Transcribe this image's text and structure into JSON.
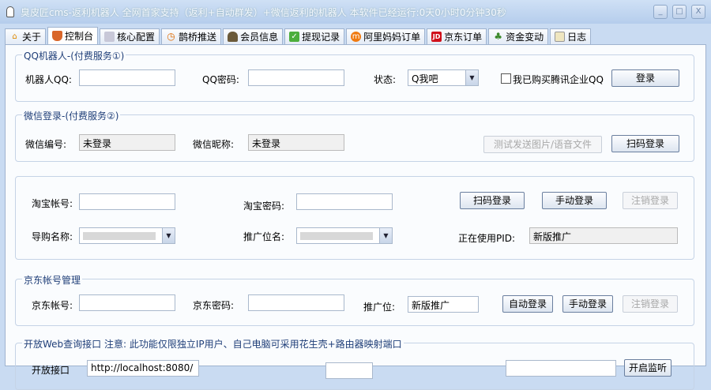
{
  "window": {
    "title": "臭皮匠cms-返利机器人 全网首家支持（返利+自动群发）+微信返利的机器人 本软件已经运行:0天0小时0分钟30秒",
    "minimize": "_",
    "maximize": "□",
    "close": "X"
  },
  "tabs": [
    {
      "label": "关于",
      "icon": "home-icon"
    },
    {
      "label": "控制台",
      "icon": "shield-icon"
    },
    {
      "label": "核心配置",
      "icon": "config-icon"
    },
    {
      "label": "鹊桥推送",
      "icon": "clock-icon"
    },
    {
      "label": "会员信息",
      "icon": "user-icon"
    },
    {
      "label": "提现记录",
      "icon": "check-icon"
    },
    {
      "label": "阿里妈妈订单",
      "icon": "alimama-icon"
    },
    {
      "label": "京东订单",
      "icon": "jd-icon"
    },
    {
      "label": "资金变动",
      "icon": "money-icon"
    },
    {
      "label": "日志",
      "icon": "log-icon"
    }
  ],
  "active_tab": "控制台",
  "qq": {
    "legend": "QQ机器人-(付费服务①)",
    "account_label": "机器人QQ:",
    "account_value": "",
    "password_label": "QQ密码:",
    "password_value": "",
    "status_label": "状态:",
    "status_value": "Q我吧",
    "enterprise_label": "我已购买腾讯企业QQ",
    "enterprise_checked": false,
    "login": "登录"
  },
  "wechat": {
    "legend": "微信登录-(付费服务②)",
    "id_label": "微信编号:",
    "id_value": "未登录",
    "nick_label": "微信昵称:",
    "nick_value": "未登录",
    "test_send": "测试发送图片/语音文件",
    "scan_login": "扫码登录"
  },
  "taobao": {
    "account_label": "淘宝帐号:",
    "account_value": "",
    "password_label": "淘宝密码:",
    "password_value": "",
    "scan_login": "扫码登录",
    "manual_login": "手动登录",
    "logout": "注销登录",
    "guide_label": "导购名称:",
    "promo_label": "推广位名:",
    "pid_label": "正在使用PID:",
    "pid_value": "新版推广"
  },
  "jd": {
    "legend": "京东帐号管理",
    "account_label": "京东帐号:",
    "account_value": "",
    "password_label": "京东密码:",
    "password_value": "",
    "promo_label": "推广位:",
    "promo_value": "新版推广",
    "auto_login": "自动登录",
    "manual_login": "手动登录",
    "logout": "注销登录"
  },
  "web": {
    "legend": "开放Web查询接口 注意: 此功能仅限独立IP用户、自己电脑可采用花生壳+路由器映射端口",
    "port_label": "开放接口",
    "url_value": "http://localhost:8080/",
    "listen": "开启监听"
  }
}
